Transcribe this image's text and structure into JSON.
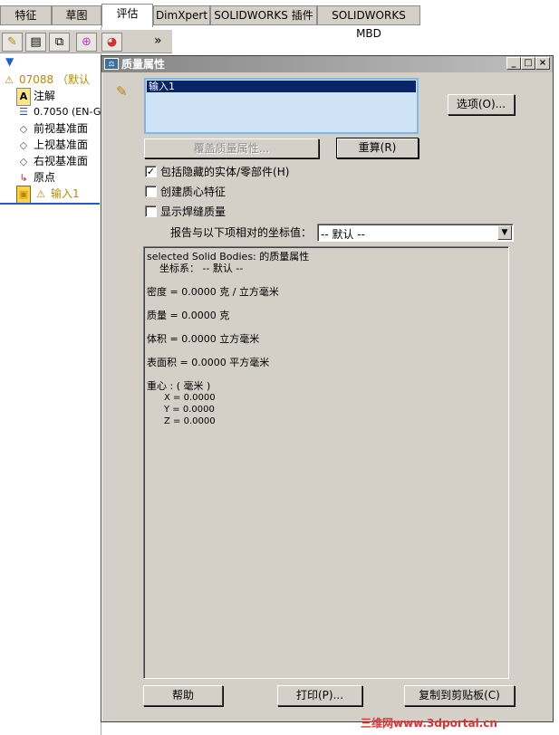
{
  "tabs": [
    {
      "label": "特征"
    },
    {
      "label": "草图"
    },
    {
      "label": "评估"
    },
    {
      "label": "DimXpert"
    },
    {
      "label": "SOLIDWORKS 插件"
    },
    {
      "label": "SOLIDWORKS MBD"
    }
  ],
  "toolbar": {
    "more_label": "»"
  },
  "tree": {
    "filter_icon": "filter-icon",
    "items": [
      {
        "label": "07088 （默认",
        "icon": "part-warning-icon"
      },
      {
        "label": "注解",
        "icon": "annotation-icon"
      },
      {
        "label": "0.7050 (EN-G",
        "icon": "material-icon"
      },
      {
        "label": "前视基准面",
        "icon": "plane-icon"
      },
      {
        "label": "上视基准面",
        "icon": "plane-icon"
      },
      {
        "label": "右视基准面",
        "icon": "plane-icon"
      },
      {
        "label": "原点",
        "icon": "origin-icon"
      },
      {
        "label": "输入1",
        "icon": "import-warning-icon"
      }
    ]
  },
  "dialog": {
    "title": "质量属性",
    "minimize": "_",
    "maximize": "□",
    "close": "×",
    "selection_item": "输入1",
    "options_button": "选项(O)...",
    "override_button": "覆盖质量属性...",
    "recalc_button": "重算(R)",
    "include_hidden_label": "包括隐藏的实体/零部件(H)",
    "include_hidden_checked": true,
    "create_com_label": "创建质心特征",
    "create_com_checked": false,
    "show_weld_label": "显示焊缝质量",
    "show_weld_checked": false,
    "coord_label": "报告与以下项相对的坐标值：",
    "coord_value": "-- 默认 --",
    "results": {
      "header": "selected Solid Bodies: 的质量属性",
      "coord_sys": "坐标系： -- 默认 --",
      "density": "密度 = 0.0000 克 / 立方毫米",
      "mass": "质量 = 0.0000 克",
      "volume": "体积 = 0.0000 立方毫米",
      "area": "表面积 = 0.0000  平方毫米",
      "com_title": "重心 : ( 毫米 )",
      "x": "X = 0.0000",
      "y": "Y = 0.0000",
      "z": "Z = 0.0000"
    },
    "help_button": "帮助",
    "print_button": "打印(P)...",
    "copy_button": "复制到剪贴板(C)"
  },
  "watermark": "三维网www.3dportal.cn",
  "colors": {
    "dialog_bg": "#d4d0c8",
    "selection": "#0a246a",
    "list_bg": "#cfe3f7",
    "warning": "#e8c000"
  }
}
